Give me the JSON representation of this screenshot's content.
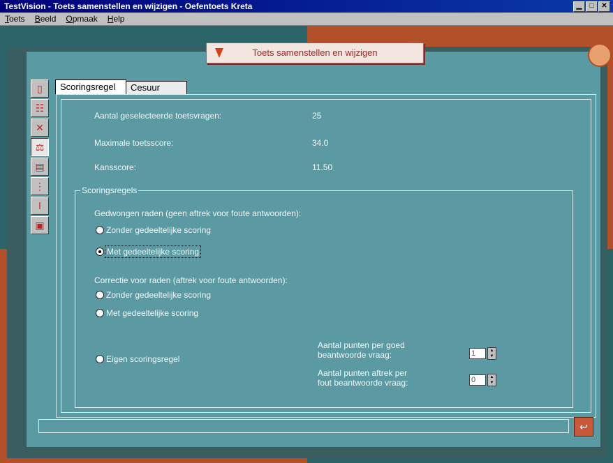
{
  "window": {
    "title": "TestVision - Toets samenstellen en wijzigen - Oefentoets Kreta",
    "minimize_glyph": "▁",
    "maximize_glyph": "□",
    "close_glyph": "✕"
  },
  "menu": [
    {
      "first": "T",
      "rest": "oets"
    },
    {
      "first": "B",
      "rest": "eeld"
    },
    {
      "first": "O",
      "rest": "pmaak"
    },
    {
      "first": "H",
      "rest": "elp"
    }
  ],
  "banner": {
    "title": "Toets samenstellen en wijzigen"
  },
  "toolbar": {
    "items": [
      {
        "icon": "new-document-icon",
        "glyph": "▯"
      },
      {
        "icon": "question-list-icon",
        "glyph": "☷"
      },
      {
        "icon": "tools-icon",
        "glyph": "✕"
      },
      {
        "icon": "scales-icon",
        "glyph": "⚖"
      },
      {
        "icon": "printer-icon",
        "glyph": "▤"
      },
      {
        "icon": "traffic-light-icon",
        "glyph": "⋮"
      },
      {
        "icon": "thermometer-icon",
        "glyph": "ǀ"
      },
      {
        "icon": "floppy-disk-icon",
        "glyph": "▣"
      }
    ]
  },
  "tabs": {
    "scoringsregel": "Scoringsregel",
    "cesuur": "Cesuur"
  },
  "stats": {
    "questions_label": "Aantal geselecteerde toetsvragen:",
    "questions_value": "25",
    "max_label": "Maximale toetsscore:",
    "max_value": "34.0",
    "chance_label": "Kansscore:",
    "chance_value": "11.50"
  },
  "group": {
    "title": "Scoringsregels",
    "forced_heading": "Gedwongen raden (geen aftrek voor foute antwoorden):",
    "forced_without": "Zonder gedeeltelijke scoring",
    "forced_with": "Met gedeeltelijke scoring",
    "correction_heading": "Correctie voor raden (aftrek voor foute antwoorden):",
    "correction_without": "Zonder gedeeltelijke scoring",
    "correction_with": "Met gedeeltelijke scoring",
    "own_rule": "Eigen scoringsregel",
    "points_correct_label_1": "Aantal punten per goed",
    "points_correct_label_2": "beantwoorde vraag:",
    "points_correct_value": "1",
    "points_wrong_label_1": "Aantal punten aftrek per",
    "points_wrong_label_2": "fout beantwoorde vraag:",
    "points_wrong_value": "0"
  },
  "colors": {
    "panel": "#5a9aa2",
    "banner_text": "#b0201f",
    "desktop_teal": "#2b6469",
    "desktop_rust": "#b2502a"
  }
}
